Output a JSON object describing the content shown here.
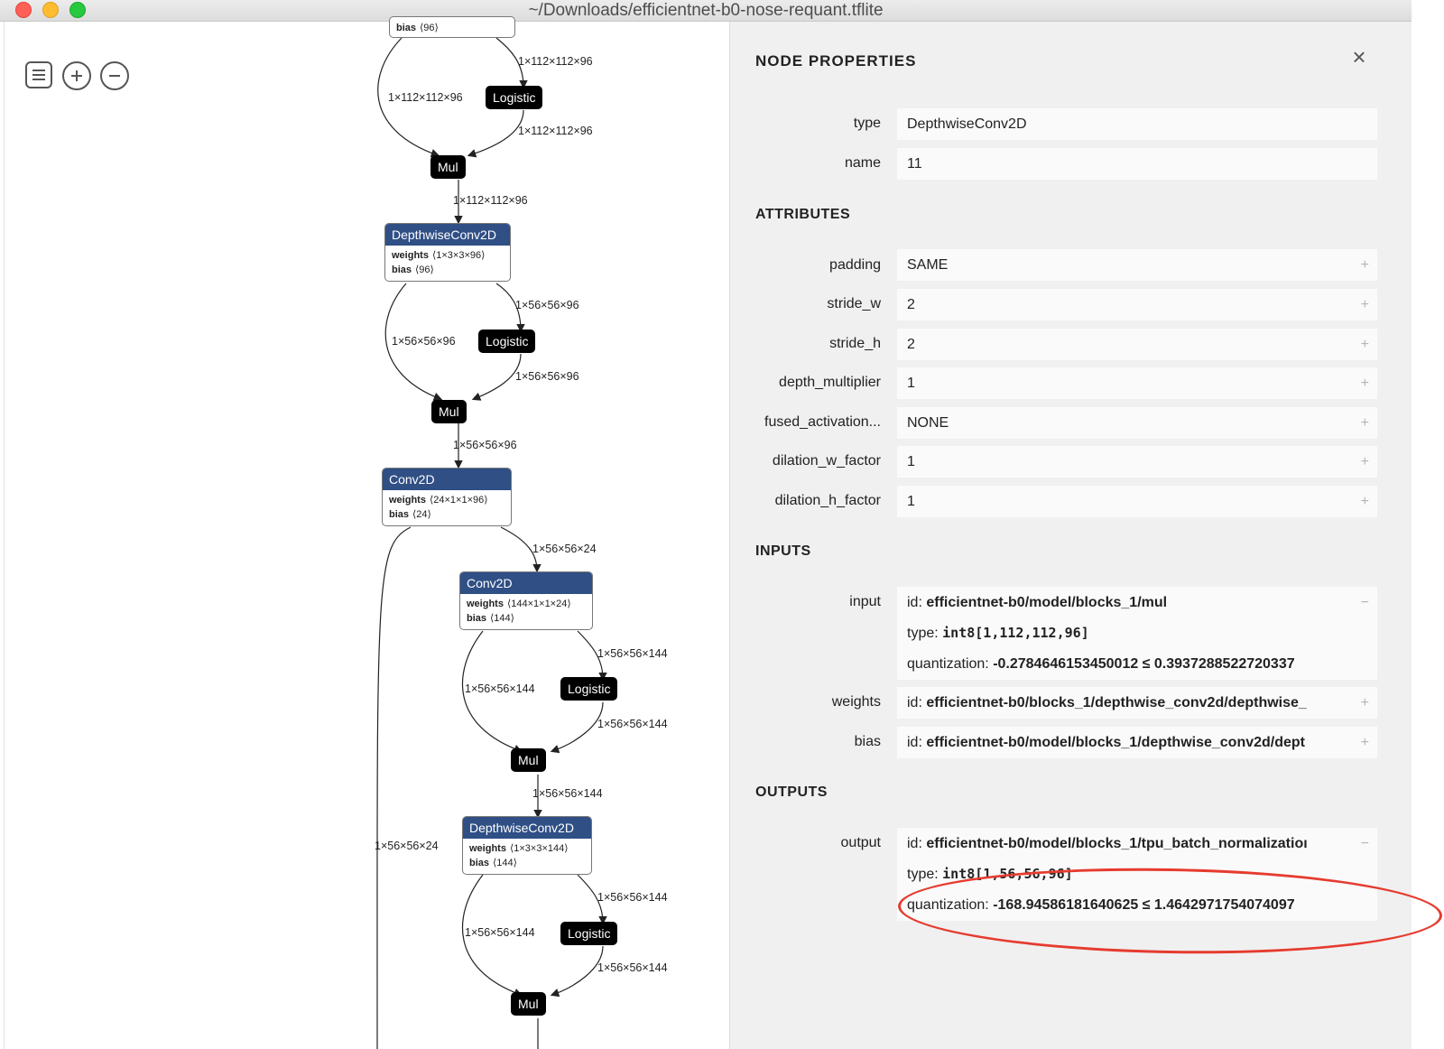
{
  "window": {
    "title": "~/Downloads/efficientnet-b0-nose-requant.tflite"
  },
  "graph": {
    "nodes": {
      "bias_top": "bias",
      "bias_top_val": "⟨96⟩",
      "logistic1": "Logistic",
      "mul1": "Mul",
      "dw1": {
        "title": "DepthwiseConv2D",
        "weights_label": "weights",
        "weights_val": "⟨1×3×3×96⟩",
        "bias_label": "bias",
        "bias_val": "⟨96⟩"
      },
      "logistic2": "Logistic",
      "mul2": "Mul",
      "conv1": {
        "title": "Conv2D",
        "weights_label": "weights",
        "weights_val": "⟨24×1×1×96⟩",
        "bias_label": "bias",
        "bias_val": "⟨24⟩"
      },
      "conv2": {
        "title": "Conv2D",
        "weights_label": "weights",
        "weights_val": "⟨144×1×1×24⟩",
        "bias_label": "bias",
        "bias_val": "⟨144⟩"
      },
      "logistic3": "Logistic",
      "mul3": "Mul",
      "dw2": {
        "title": "DepthwiseConv2D",
        "weights_label": "weights",
        "weights_val": "⟨1×3×3×144⟩",
        "bias_label": "bias",
        "bias_val": "⟨144⟩"
      },
      "logistic4": "Logistic",
      "mul4": "Mul"
    },
    "edges": {
      "e1": "1×112×112×96",
      "e2": "1×112×112×96",
      "e3": "1×112×112×96",
      "e4": "1×112×112×96",
      "e5": "1×56×56×96",
      "e6": "1×56×56×96",
      "e7": "1×56×56×96",
      "e8": "1×56×56×96",
      "e9": "1×56×56×24",
      "e10": "1×56×56×144",
      "e11": "1×56×56×144",
      "e12": "1×56×56×144",
      "e13": "1×56×56×144",
      "e14": "1×56×56×24",
      "e15": "1×56×56×144",
      "e16": "1×56×56×144",
      "e17": "1×56×56×144"
    }
  },
  "panel": {
    "title": "NODE PROPERTIES",
    "close_icon": "×",
    "properties": [
      {
        "name": "type",
        "value": "DepthwiseConv2D"
      },
      {
        "name": "name",
        "value": "11"
      }
    ],
    "attributes_heading": "ATTRIBUTES",
    "attributes": [
      {
        "name": "padding",
        "value": "SAME"
      },
      {
        "name": "stride_w",
        "value": "2"
      },
      {
        "name": "stride_h",
        "value": "2"
      },
      {
        "name": "depth_multiplier",
        "value": "1"
      },
      {
        "name": "fused_activation...",
        "value": "NONE"
      },
      {
        "name": "dilation_w_factor",
        "value": "1"
      },
      {
        "name": "dilation_h_factor",
        "value": "1"
      }
    ],
    "plus": "+",
    "minus": "−",
    "inputs_heading": "INPUTS",
    "inputs": {
      "input_name": "input",
      "input_id_label": "id:",
      "input_id": "efficientnet-b0/model/blocks_1/mul",
      "input_type_label": "type:",
      "input_type": "int8[1,112,112,96]",
      "input_quant_label": "quantization:",
      "input_quant": "-0.2784646153450012 ≤ 0.3937288522720337",
      "weights_name": "weights",
      "weights_id_label": "id:",
      "weights_id": "efficientnet-b0/blocks_1/depthwise_conv2d/depthwise_",
      "bias_name": "bias",
      "bias_id_label": "id:",
      "bias_id": "efficientnet-b0/model/blocks_1/depthwise_conv2d/dept"
    },
    "outputs_heading": "OUTPUTS",
    "outputs": {
      "output_name": "output",
      "output_id_label": "id:",
      "output_id": "efficientnet-b0/model/blocks_1/tpu_batch_normalizatioı",
      "output_type_label": "type:",
      "output_type": "int8[1,56,56,96]",
      "output_quant_label": "quantization:",
      "output_quant": "-168.94586181640625 ≤ 1.4642971754074097"
    }
  }
}
